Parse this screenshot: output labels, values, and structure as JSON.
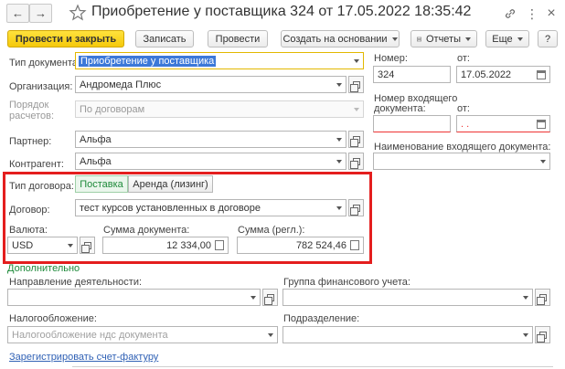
{
  "window": {
    "title": "Приобретение у поставщика 324 от 17.05.2022 18:35:42",
    "more_icon": "⋮",
    "close_icon": "×"
  },
  "toolbar": {
    "post_close": "Провести и закрыть",
    "save": "Записать",
    "post": "Провести",
    "create_based": "Создать на основании",
    "reports": "Отчеты",
    "more": "Еще",
    "help": "?"
  },
  "form": {
    "doc_type_label": "Тип документа:",
    "doc_type_value": "Приобретение у поставщика",
    "org_label": "Организация:",
    "org_value": "Андромеда Плюс",
    "settlement_label_1": "Порядок",
    "settlement_label_2": "расчетов:",
    "settlement_value": "По договорам",
    "partner_label": "Партнер:",
    "partner_value": "Альфа",
    "contractor_label": "Контрагент:",
    "contractor_value": "Альфа",
    "number_label": "Номер:",
    "number_value": "324",
    "date_label": "от:",
    "date_value": "17.05.2022",
    "incoming_num_label_1": "Номер входящего",
    "incoming_num_label_2": "документа:",
    "incoming_date_label": "от:",
    "incoming_date_value": " .  .",
    "incoming_name_label": "Наименование входящего документа:",
    "contract_type_label": "Тип договора:",
    "contract_type_supply": "Поставка",
    "contract_type_lease": "Аренда (лизинг)",
    "contract_label": "Договор:",
    "contract_value": "тест курсов установленных в договоре",
    "currency_label": "Валюта:",
    "currency_value": "USD",
    "doc_sum_label": "Сумма документа:",
    "doc_sum_value": "12 334,00",
    "reg_sum_label": "Сумма (регл.):",
    "reg_sum_value": "782 524,46",
    "additional_label": "Дополнительно",
    "activity_label": "Направление деятельности:",
    "fin_group_label": "Группа финансового учета:",
    "tax_label": "Налогообложение:",
    "tax_placeholder": "Налогообложение ндс документа",
    "division_label": "Подразделение:",
    "register_invoice_link": "Зарегистрировать счет-фактуру"
  },
  "colors": {
    "primary": "#f5c90b",
    "highlight_border": "#e41e1e",
    "selected_text_bg": "#3c78d8",
    "link": "#3061b5",
    "supply_green": "#1e8a3a"
  }
}
